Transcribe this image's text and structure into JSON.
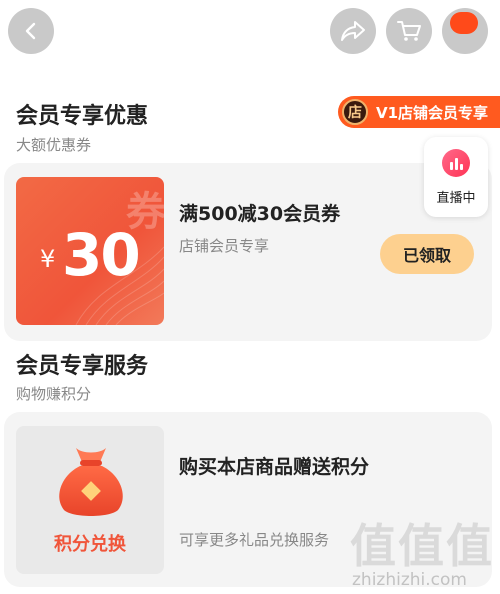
{
  "topbar": {
    "back_icon": "chevron-left-icon",
    "share_icon": "share-icon",
    "cart_icon": "cart-icon",
    "more_icon": "more-icon"
  },
  "member_deals": {
    "title": "会员专享优惠",
    "subtitle": "大额优惠券",
    "shop_tag": {
      "icon_char": "店",
      "label": "V1店铺会员专享"
    }
  },
  "coupon": {
    "watermark": "券",
    "currency": "¥",
    "amount": "30",
    "title": "满500减30会员券",
    "desc": "店铺会员专享",
    "claim_label": "已领取"
  },
  "live": {
    "label": "直播中"
  },
  "member_services": {
    "title": "会员专享服务",
    "subtitle": "购物赚积分"
  },
  "points": {
    "image_label": "积分兑换",
    "title": "购买本店商品赠送积分",
    "desc": "可享更多礼品兑换服务"
  },
  "watermark": {
    "chars": "值值值",
    "url": "zhizhizhi.com"
  },
  "colors": {
    "accent": "#f0553a",
    "tag_bg": "#ff5a1f",
    "claim_bg": "#fdd08f",
    "card_bg": "#f4f4f4"
  }
}
